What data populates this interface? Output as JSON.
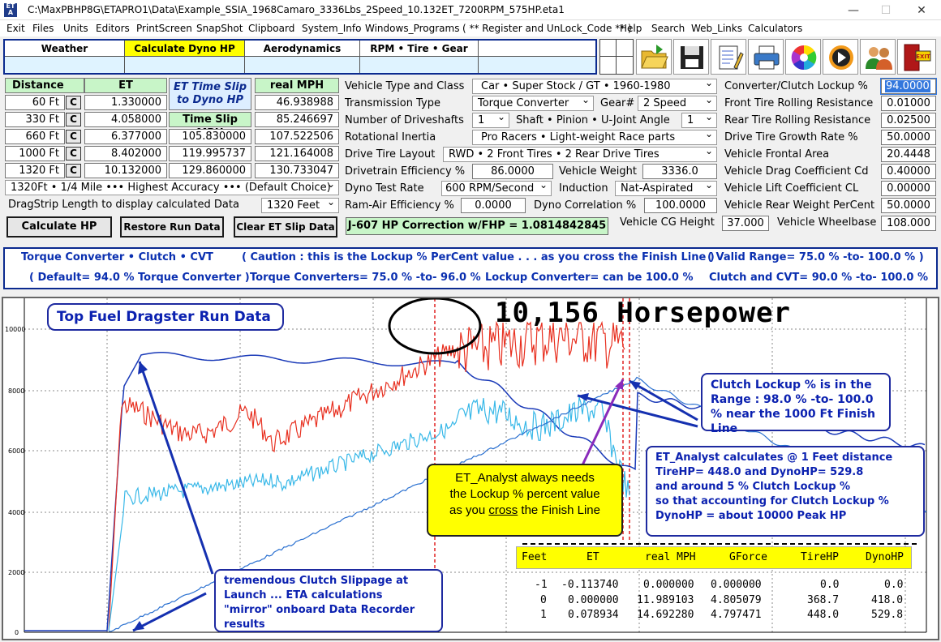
{
  "window": {
    "title": "C:\\MaxPBHP8G\\ETAPRO1\\Data\\Example_SSIA_1968Camaro_3336Lbs_2Speed_10.132ET_7200RPM_575HP.eta1",
    "app_icon": "ETA"
  },
  "menu": [
    "Exit",
    "Files",
    "Units",
    "Editors",
    "PrintScreen",
    "SnapShot",
    "Clipboard",
    "System_Info",
    "Windows_Programs",
    "( ** Register and UnLock_Code ** )",
    "Help",
    "Search",
    "Web_Links",
    "Calculators"
  ],
  "tabs": [
    "Weather",
    "Calculate Dyno HP",
    "Aerodynamics",
    "RPM  •  Tire  •  Gear"
  ],
  "toolbar_icons": [
    "open-folder-icon",
    "save-disk-icon",
    "edit-notepad-icon",
    "printer-icon",
    "color-wheel-icon",
    "media-player-icon",
    "users-icon",
    "exit-icon"
  ],
  "toolbar_exit_label": "EXIT",
  "runs": {
    "header_distance": "Distance",
    "header_et": "ET",
    "header_slip": "ET Time Slip to Dyno HP",
    "header_timeslip_mph": "Time Slip MPH",
    "header_real_mph": "real  MPH",
    "c_label": "C",
    "rows": [
      {
        "dist": "60 Ft",
        "et": "1.330000",
        "slip": "",
        "mph": "46.938988"
      },
      {
        "dist": "330 Ft",
        "et": "4.058000",
        "slip": "",
        "mph": "85.246697"
      },
      {
        "dist": "660 Ft",
        "et": "6.377000",
        "slip": "105.830000",
        "mph": "107.522506"
      },
      {
        "dist": "1000 Ft",
        "et": "8.402000",
        "slip": "119.995737",
        "mph": "121.164008"
      },
      {
        "dist": "1320 Ft",
        "et": "10.132000",
        "slip": "129.860000",
        "mph": "130.733047"
      }
    ],
    "accuracy": "1320Ft • 1/4 Mile ••• Highest Accuracy ••• (Default Choice)",
    "dragstrip_label": "DragStrip Length to display calculated Data",
    "dragstrip_value": "1320 Feet"
  },
  "buttons": {
    "calc": "Calculate  HP",
    "restore": "Restore Run Data",
    "clear": "Clear ET Slip Data"
  },
  "correction": "J-607 HP Correction w/FHP = 1.0814842845",
  "vehicle": {
    "type_label": "Vehicle Type and Class",
    "type_value": "Car  •  Super Stock / GT  •  1960-1980",
    "trans_label": "Transmission Type",
    "trans_value": "Torque Converter",
    "gear_label": "Gear#",
    "gear_value": "2  Speed",
    "shafts_label": "Number of Driveshafts",
    "shafts_value": "1",
    "ujoint_label": "Shaft • Pinion • U-Joint Angle",
    "ujoint_value": "1",
    "inertia_label": "Rotational Inertia",
    "inertia_value": "Pro Racers  •  Light-weight Race parts",
    "drive_label": "Drive Tire Layout",
    "drive_value": "RWD • 2  Front Tires  •  2  Rear Drive Tires",
    "eff_label": "Drivetrain Efficiency %",
    "eff_value": "86.0000",
    "weight_label": "Vehicle Weight",
    "weight_value": "3336.0",
    "dyno_label": "Dyno Test Rate",
    "dyno_value": "600 RPM/Second",
    "induction_label": "Induction",
    "induction_value": "Nat-Aspirated",
    "ram_label": "Ram-Air Efficiency %",
    "ram_value": "0.0000",
    "dcorr_label": "Dyno Correlation %",
    "dcorr_value": "100.0000",
    "cg_label": "Vehicle CG Height",
    "cg_value": "37.000",
    "wb_label": "Vehicle Wheelbase",
    "wb_value": "108.000"
  },
  "right": [
    {
      "label": "Converter/Clutch Lockup %",
      "value": "94.0000"
    },
    {
      "label": "Front Tire Rolling Resistance",
      "value": "0.01000"
    },
    {
      "label": "Rear Tire Rolling Resistance",
      "value": "0.02500"
    },
    {
      "label": "Drive Tire Growth Rate %",
      "value": "50.0000"
    },
    {
      "label": "Vehicle Frontal Area",
      "value": "20.4448"
    },
    {
      "label": "Vehicle Drag Coefficient  Cd",
      "value": "0.40000"
    },
    {
      "label": "Vehicle Lift Coefficient   CL",
      "value": "0.00000"
    },
    {
      "label": "Vehicle Rear Weight PerCent",
      "value": "50.0000"
    }
  ],
  "info": {
    "l1a": "Torque Converter  •  Clutch  •  CVT",
    "l1b": "( Caution :  this is the Lockup %  PerCent value . . . as you cross the Finish Line )",
    "l1c": "( Valid Range= 75.0 %  -to-  100.0 % )",
    "l2a": "( Default= 94.0 % Torque Converter )",
    "l2b": "Torque Converters= 75.0 % -to- 96.0 %",
    "l2c": "Lockup Converter= can be 100.0 %",
    "l2d": "Clutch and CVT= 90.0 % -to- 100.0 %"
  },
  "chart": {
    "title_box": "Top Fuel Dragster  Run Data",
    "big_title": "10,156 Horsepower",
    "yticks": [
      "10000",
      "8000",
      "6000",
      "4000",
      "2000",
      "0"
    ],
    "callout_clutch": "Clutch Lockup % is in the Range :  98.0 % -to- 100.0 % near the 1000 Ft Finish Line",
    "callout_eta_1": "ET_Analyst calculates @  1 Feet distance",
    "callout_eta_2": "TireHP= 448.0    and    DynoHP= 529.8",
    "callout_eta_3": "and around 5 % Clutch Lockup %",
    "callout_eta_4": "so that accounting for Clutch Lockup %",
    "callout_eta_5": "DynoHP = about 10000 Peak HP",
    "yellow_1": "ET_Analyst always needs",
    "yellow_2": "the Lockup %  percent value",
    "yellow_3a": "as you ",
    "yellow_3b": "cross",
    "yellow_3c": " the Finish Line",
    "slip_note": "tremendous Clutch Slippage at Launch ... ETA calculations \"mirror\" onboard Data Recorder results",
    "table_headers": [
      "Feet",
      "ET",
      "real MPH",
      "GForce",
      "TireHP",
      "DynoHP"
    ],
    "table_rows": [
      [
        "-1",
        "-0.113740",
        "0.000000",
        "0.000000",
        "0.0",
        "0.0"
      ],
      [
        "0",
        "0.000000",
        "11.989103",
        "4.805079",
        "368.7",
        "418.0"
      ],
      [
        "1",
        "0.078934",
        "14.692280",
        "4.797471",
        "448.0",
        "529.8"
      ]
    ]
  }
}
